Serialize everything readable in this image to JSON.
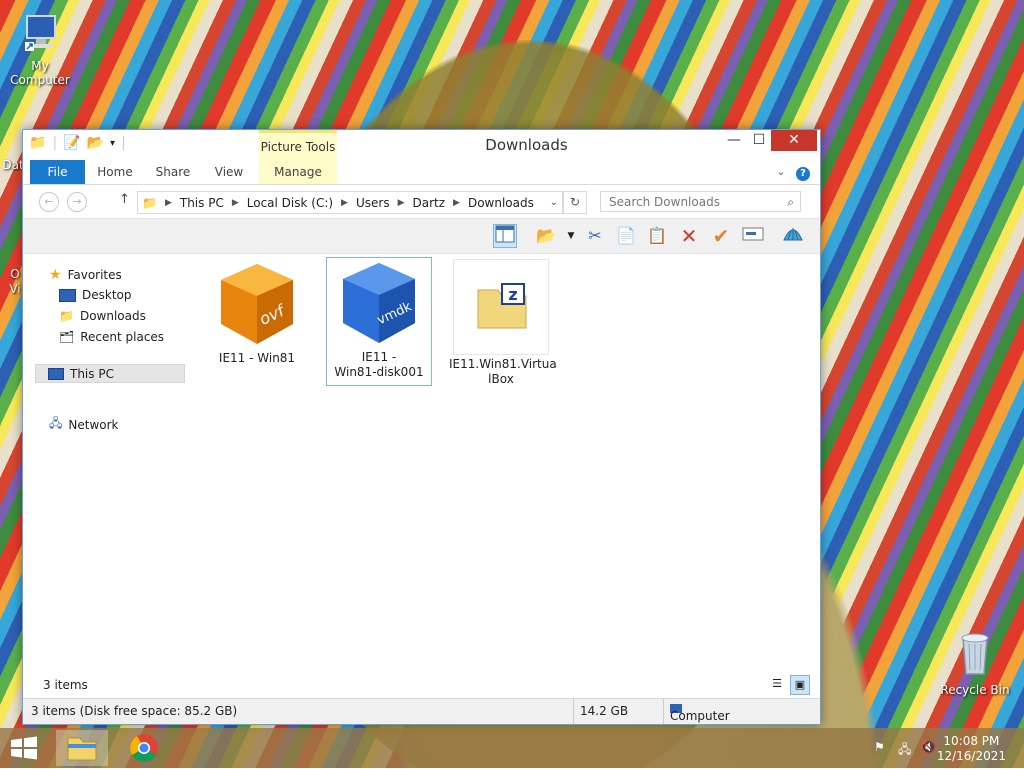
{
  "desktop": {
    "icons": [
      {
        "label": "My Computer",
        "icon": "computer-icon"
      },
      {
        "label": "Dat",
        "icon": "folder-icon"
      },
      {
        "label": "O",
        "icon": "app-icon"
      },
      {
        "label": "Vi",
        "icon": "app-icon"
      },
      {
        "label": "Recycle Bin",
        "icon": "recycle-bin-icon"
      }
    ]
  },
  "window": {
    "title": "Downloads",
    "context_group": "Picture Tools",
    "tabs": [
      "File",
      "Home",
      "Share",
      "View",
      "Manage"
    ],
    "controls": {
      "minimize": "—",
      "maximize": "☐",
      "close": "✕"
    },
    "address": [
      "This PC",
      "Local Disk (C:)",
      "Users",
      "Dartz",
      "Downloads"
    ],
    "search_placeholder": "Search Downloads",
    "nav": {
      "favorites": "Favorites",
      "desktop": "Desktop",
      "downloads": "Downloads",
      "recent": "Recent places",
      "this_pc": "This PC",
      "network": "Network"
    },
    "items": [
      {
        "name": "IE11 - Win81",
        "badge": "ovf",
        "color": "#f09a1a"
      },
      {
        "name": "IE11 - Win81-disk001",
        "name_line1": "IE11 -",
        "name_line2": "Win81-disk001",
        "badge": "vmdk",
        "color": "#2d6fd6"
      },
      {
        "name": "IE11.Win81.VirtualBox",
        "name_line1": "IE11.Win81.Virtua",
        "name_line2": "lBox",
        "badge": "z"
      }
    ],
    "item_count": "3 items",
    "status": {
      "left": "3 items (Disk free space: 85.2 GB)",
      "size": "14.2 GB",
      "location": "Computer"
    }
  },
  "taskbar": {
    "time": "10:08 PM",
    "date": "12/16/2021"
  }
}
